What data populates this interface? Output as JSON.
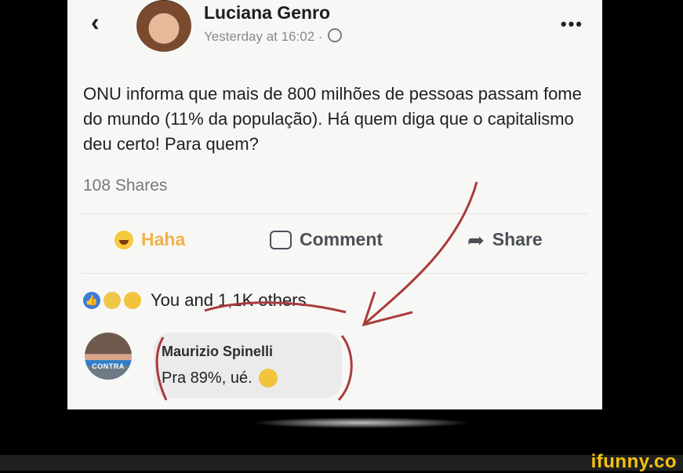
{
  "post": {
    "author": "Luciana Genro",
    "timestamp": "Yesterday at 16:02 ·",
    "text": "ONU informa que mais de 800 milhões de pessoas passam fome do mundo (11% da população). Há quem diga que o capitalismo deu certo! Para quem?",
    "shares": "108 Shares"
  },
  "actions": {
    "haha": "Haha",
    "comment": "Comment",
    "share": "Share"
  },
  "reactions": {
    "summary": "You and 1,1K others"
  },
  "comment": {
    "author": "Maurizio Spinelli",
    "text": "Pra 89%, ué.",
    "avatar_badge": "CONTRA"
  },
  "watermark": "ifunny.co",
  "icons": [
    "chevron-left-icon",
    "globe-icon",
    "more-icon",
    "haha-icon",
    "comment-icon",
    "share-icon",
    "like-icon",
    "sad-icon",
    "think-emoji-icon"
  ],
  "colors": {
    "annotation": "#a93b3b",
    "haha": "#f0b34a",
    "like": "#3b7bd8",
    "watermark": "#f4c20d"
  }
}
